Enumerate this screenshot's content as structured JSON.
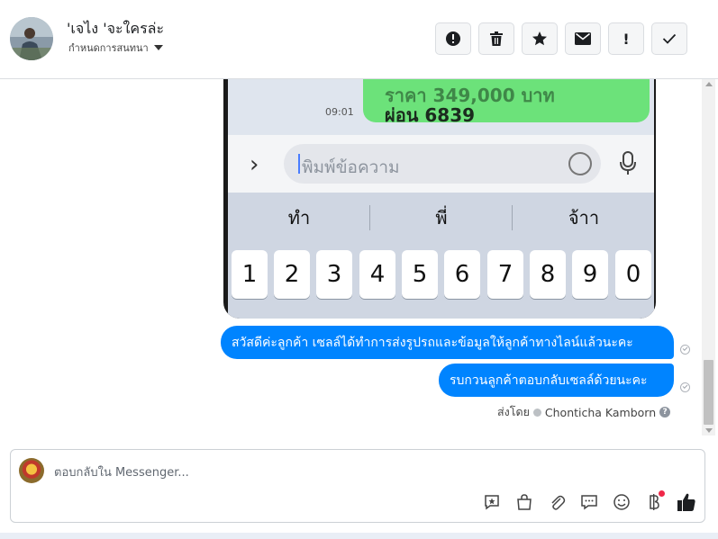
{
  "header": {
    "contact_name": "'เจไง 'จะใครล่ะ",
    "assign_label": "กำหนดการสนทนา",
    "actions": [
      {
        "name": "mark-spam-button",
        "icon": "alert-circle-icon"
      },
      {
        "name": "delete-button",
        "icon": "trash-icon"
      },
      {
        "name": "star-button",
        "icon": "star-icon"
      },
      {
        "name": "mark-unread-button",
        "icon": "envelope-icon"
      },
      {
        "name": "follow-up-button",
        "label": "!"
      },
      {
        "name": "done-button",
        "icon": "check-icon"
      }
    ]
  },
  "shared_image": {
    "price_line": "ราคา 349,000 บาท",
    "installment_line": "ผ่อน 6839",
    "time": "09:01",
    "input_placeholder": "พิมพ์ข้อความ",
    "suggestions": [
      "ทำ",
      "พี่",
      "จ้าา"
    ],
    "keys": [
      "1",
      "2",
      "3",
      "4",
      "5",
      "6",
      "7",
      "8",
      "9",
      "0"
    ]
  },
  "messages": [
    {
      "text": "สวัสดีค่ะลูกค้า เซลล์ได้ทำการส่งรูปรถและข้อมูลให้ลูกค้าทางไลน์แล้วนะคะ"
    },
    {
      "text": "รบกวนลูกค้าตอบกลับเซลล์ด้วยนะคะ"
    }
  ],
  "sent_by": {
    "prefix": "ส่งโดย",
    "name": "Chonticha Kamborn"
  },
  "composer": {
    "placeholder": "ตอบกลับใน Messenger...",
    "tools": [
      "saved-reply-icon",
      "shop-bag-icon",
      "attachment-icon",
      "chat-bubble-icon",
      "emoji-icon",
      "baht-payment-icon",
      "thumbs-up-icon"
    ]
  },
  "colors": {
    "bubble_blue": "#0084ff",
    "green_bubble": "#6ce27a"
  }
}
